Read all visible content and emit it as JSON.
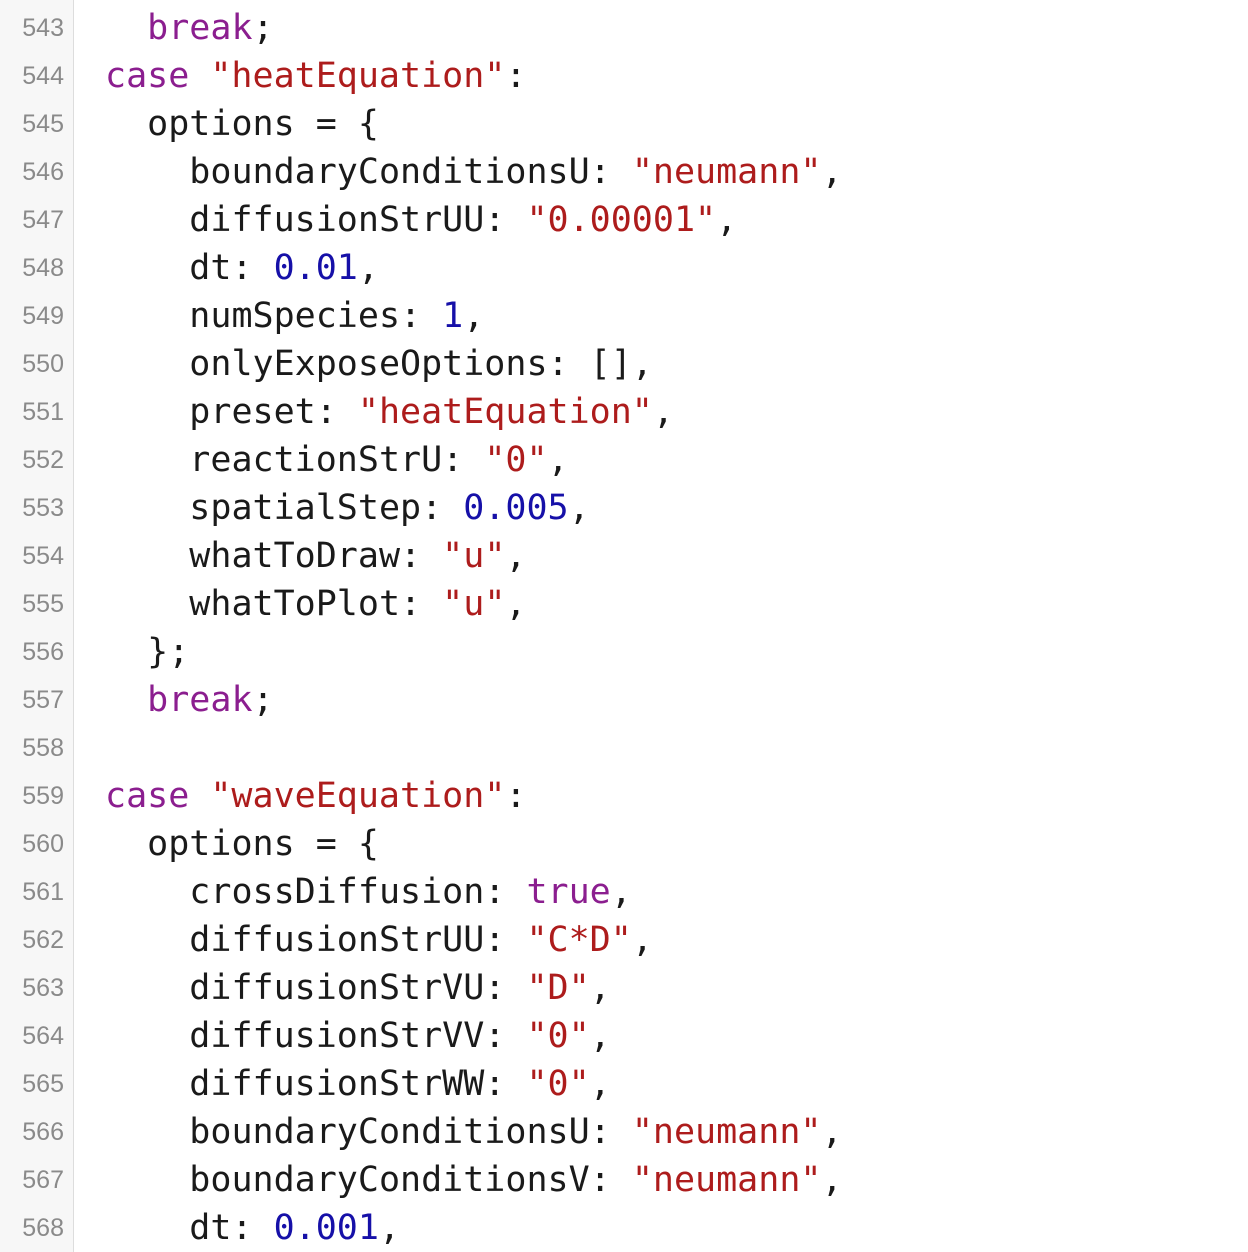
{
  "colors": {
    "keyword": "#8b1e8f",
    "string": "#ad1c1c",
    "number": "#1610a8",
    "plain": "#1a1a1a",
    "line_number": "#8a8a8a",
    "gutter_bg": "#f7f7f7"
  },
  "lines": [
    {
      "num": "543",
      "indent": "  ",
      "tokens": [
        {
          "t": "break",
          "k": "kw"
        },
        {
          "t": ";",
          "k": "plain"
        }
      ]
    },
    {
      "num": "544",
      "indent": "",
      "tokens": [
        {
          "t": "case ",
          "k": "kw"
        },
        {
          "t": "\"heatEquation\"",
          "k": "str"
        },
        {
          "t": ":",
          "k": "plain"
        }
      ]
    },
    {
      "num": "545",
      "indent": "  ",
      "tokens": [
        {
          "t": "options = {",
          "k": "plain"
        }
      ]
    },
    {
      "num": "546",
      "indent": "    ",
      "tokens": [
        {
          "t": "boundaryConditionsU: ",
          "k": "plain"
        },
        {
          "t": "\"neumann\"",
          "k": "str"
        },
        {
          "t": ",",
          "k": "plain"
        }
      ]
    },
    {
      "num": "547",
      "indent": "    ",
      "tokens": [
        {
          "t": "diffusionStrUU: ",
          "k": "plain"
        },
        {
          "t": "\"0.00001\"",
          "k": "str"
        },
        {
          "t": ",",
          "k": "plain"
        }
      ]
    },
    {
      "num": "548",
      "indent": "    ",
      "tokens": [
        {
          "t": "dt: ",
          "k": "plain"
        },
        {
          "t": "0.01",
          "k": "num"
        },
        {
          "t": ",",
          "k": "plain"
        }
      ]
    },
    {
      "num": "549",
      "indent": "    ",
      "tokens": [
        {
          "t": "numSpecies: ",
          "k": "plain"
        },
        {
          "t": "1",
          "k": "num"
        },
        {
          "t": ",",
          "k": "plain"
        }
      ]
    },
    {
      "num": "550",
      "indent": "    ",
      "tokens": [
        {
          "t": "onlyExposeOptions: [],",
          "k": "plain"
        }
      ]
    },
    {
      "num": "551",
      "indent": "    ",
      "tokens": [
        {
          "t": "preset: ",
          "k": "plain"
        },
        {
          "t": "\"heatEquation\"",
          "k": "str"
        },
        {
          "t": ",",
          "k": "plain"
        }
      ]
    },
    {
      "num": "552",
      "indent": "    ",
      "tokens": [
        {
          "t": "reactionStrU: ",
          "k": "plain"
        },
        {
          "t": "\"0\"",
          "k": "str"
        },
        {
          "t": ",",
          "k": "plain"
        }
      ]
    },
    {
      "num": "553",
      "indent": "    ",
      "tokens": [
        {
          "t": "spatialStep: ",
          "k": "plain"
        },
        {
          "t": "0.005",
          "k": "num"
        },
        {
          "t": ",",
          "k": "plain"
        }
      ]
    },
    {
      "num": "554",
      "indent": "    ",
      "tokens": [
        {
          "t": "whatToDraw: ",
          "k": "plain"
        },
        {
          "t": "\"u\"",
          "k": "str"
        },
        {
          "t": ",",
          "k": "plain"
        }
      ]
    },
    {
      "num": "555",
      "indent": "    ",
      "tokens": [
        {
          "t": "whatToPlot: ",
          "k": "plain"
        },
        {
          "t": "\"u\"",
          "k": "str"
        },
        {
          "t": ",",
          "k": "plain"
        }
      ]
    },
    {
      "num": "556",
      "indent": "  ",
      "tokens": [
        {
          "t": "};",
          "k": "plain"
        }
      ]
    },
    {
      "num": "557",
      "indent": "  ",
      "tokens": [
        {
          "t": "break",
          "k": "kw"
        },
        {
          "t": ";",
          "k": "plain"
        }
      ]
    },
    {
      "num": "558",
      "indent": "",
      "tokens": []
    },
    {
      "num": "559",
      "indent": "",
      "tokens": [
        {
          "t": "case ",
          "k": "kw"
        },
        {
          "t": "\"waveEquation\"",
          "k": "str"
        },
        {
          "t": ":",
          "k": "plain"
        }
      ]
    },
    {
      "num": "560",
      "indent": "  ",
      "tokens": [
        {
          "t": "options = {",
          "k": "plain"
        }
      ]
    },
    {
      "num": "561",
      "indent": "    ",
      "tokens": [
        {
          "t": "crossDiffusion: ",
          "k": "plain"
        },
        {
          "t": "true",
          "k": "kw"
        },
        {
          "t": ",",
          "k": "plain"
        }
      ]
    },
    {
      "num": "562",
      "indent": "    ",
      "tokens": [
        {
          "t": "diffusionStrUU: ",
          "k": "plain"
        },
        {
          "t": "\"C*D\"",
          "k": "str"
        },
        {
          "t": ",",
          "k": "plain"
        }
      ]
    },
    {
      "num": "563",
      "indent": "    ",
      "tokens": [
        {
          "t": "diffusionStrVU: ",
          "k": "plain"
        },
        {
          "t": "\"D\"",
          "k": "str"
        },
        {
          "t": ",",
          "k": "plain"
        }
      ]
    },
    {
      "num": "564",
      "indent": "    ",
      "tokens": [
        {
          "t": "diffusionStrVV: ",
          "k": "plain"
        },
        {
          "t": "\"0\"",
          "k": "str"
        },
        {
          "t": ",",
          "k": "plain"
        }
      ]
    },
    {
      "num": "565",
      "indent": "    ",
      "tokens": [
        {
          "t": "diffusionStrWW: ",
          "k": "plain"
        },
        {
          "t": "\"0\"",
          "k": "str"
        },
        {
          "t": ",",
          "k": "plain"
        }
      ]
    },
    {
      "num": "566",
      "indent": "    ",
      "tokens": [
        {
          "t": "boundaryConditionsU: ",
          "k": "plain"
        },
        {
          "t": "\"neumann\"",
          "k": "str"
        },
        {
          "t": ",",
          "k": "plain"
        }
      ]
    },
    {
      "num": "567",
      "indent": "    ",
      "tokens": [
        {
          "t": "boundaryConditionsV: ",
          "k": "plain"
        },
        {
          "t": "\"neumann\"",
          "k": "str"
        },
        {
          "t": ",",
          "k": "plain"
        }
      ]
    },
    {
      "num": "568",
      "indent": "    ",
      "tokens": [
        {
          "t": "dt: ",
          "k": "plain"
        },
        {
          "t": "0.001",
          "k": "num"
        },
        {
          "t": ",",
          "k": "plain"
        }
      ]
    }
  ]
}
